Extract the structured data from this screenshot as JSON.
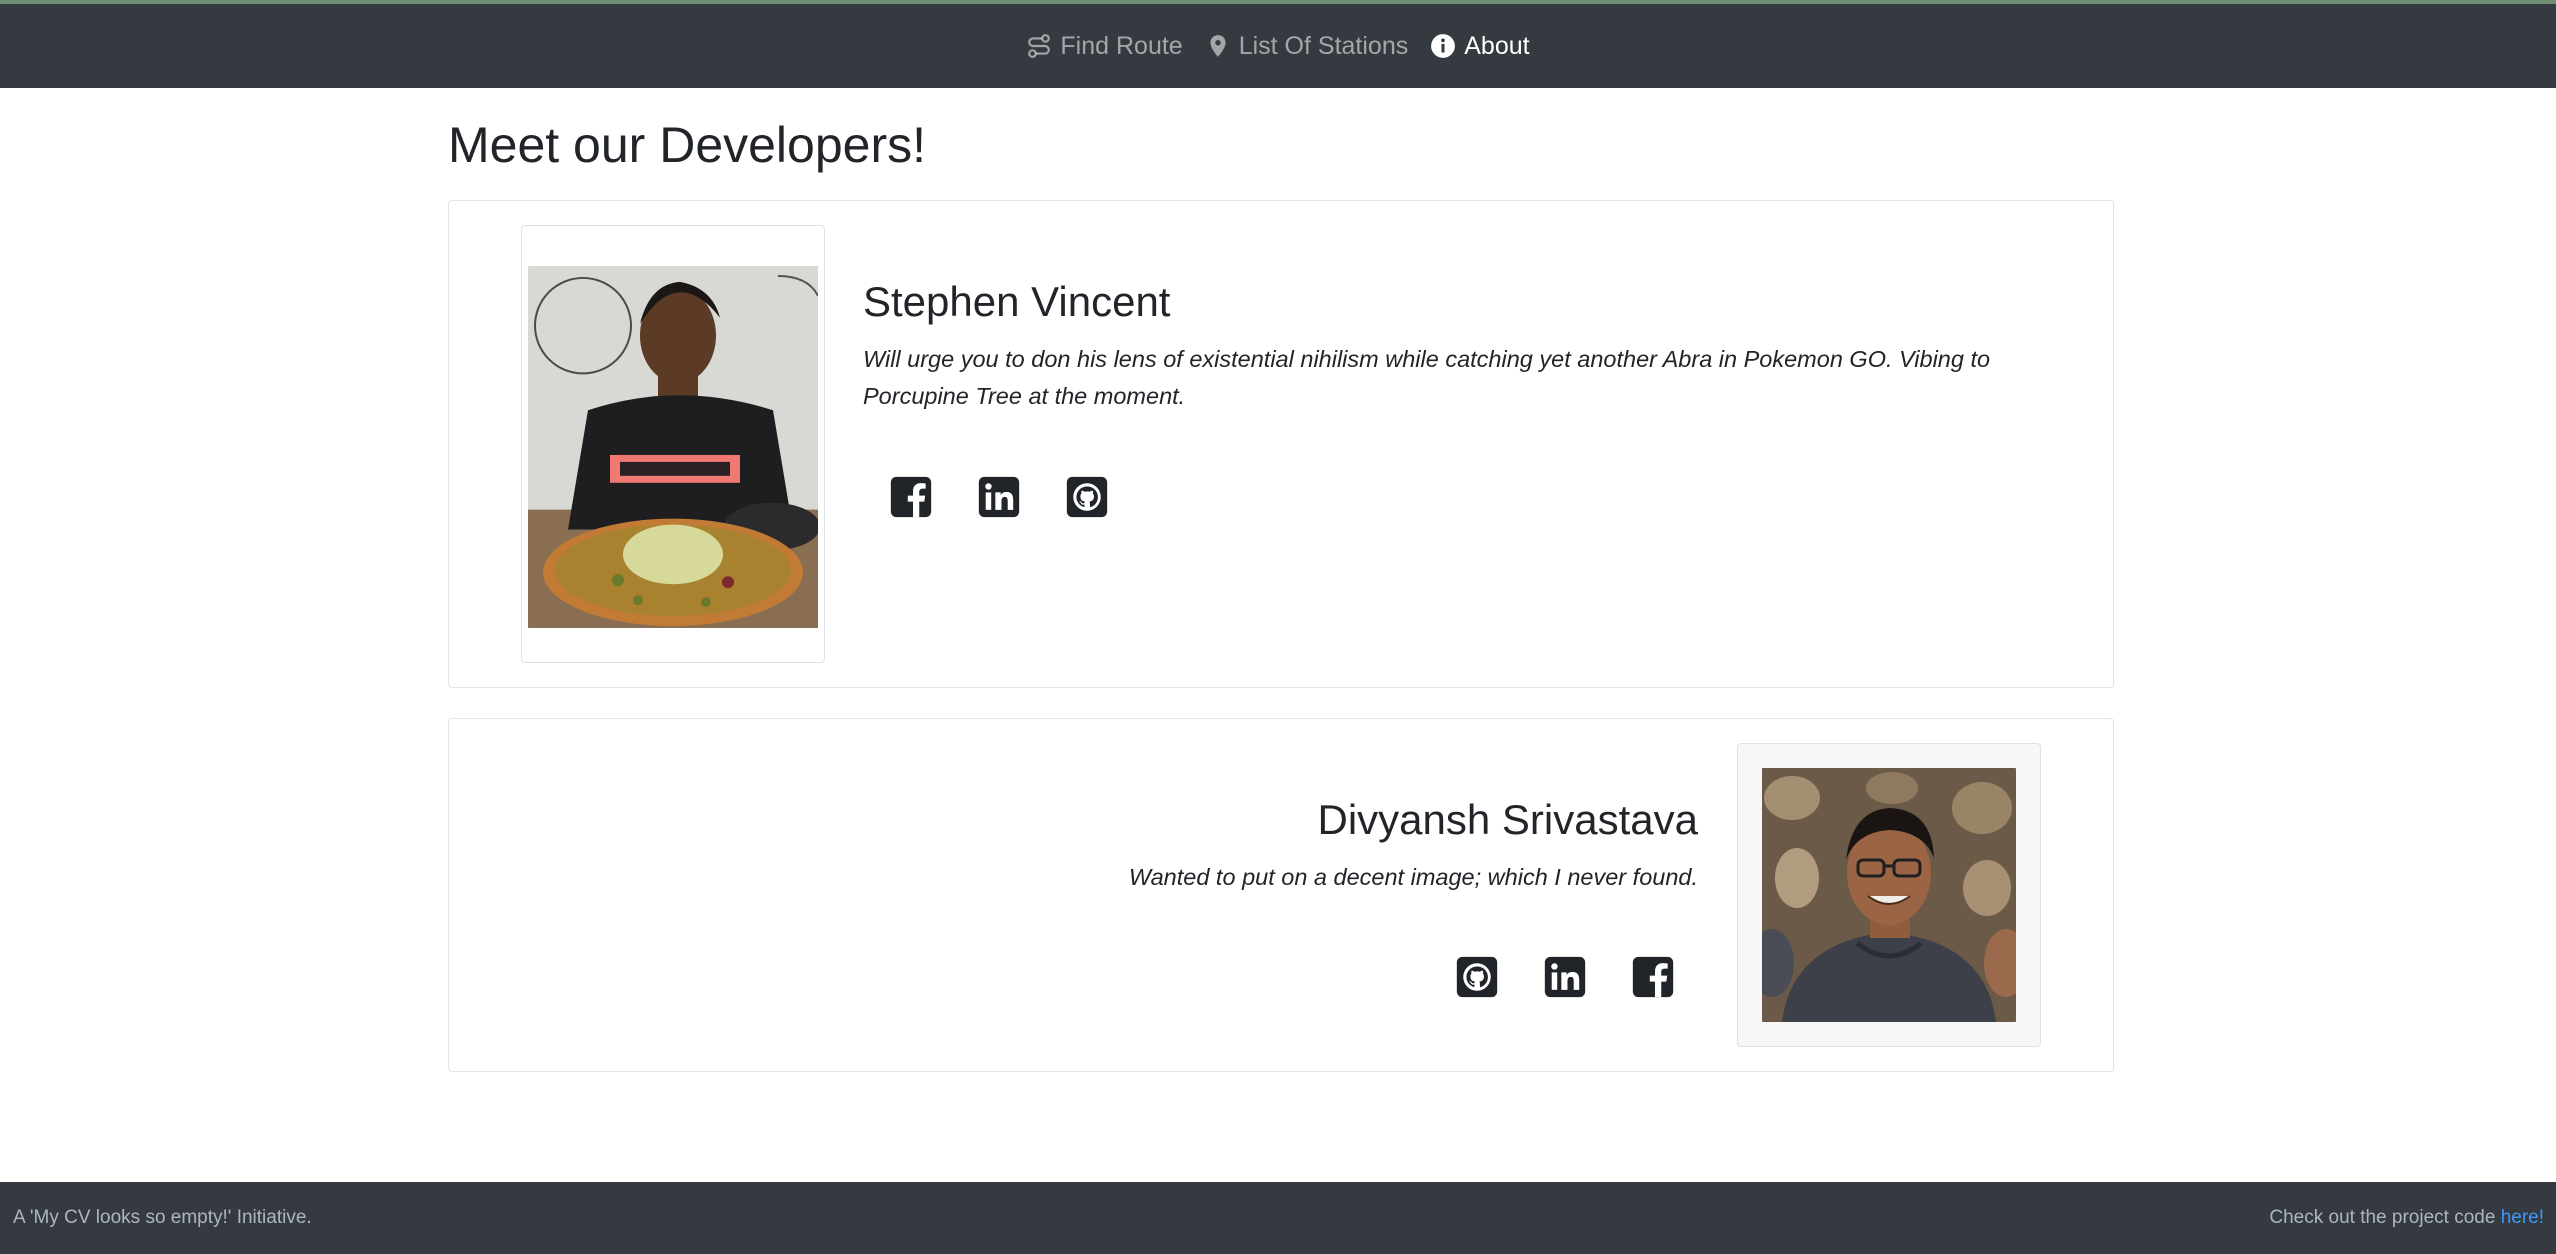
{
  "navbar": {
    "items": [
      {
        "label": "Find Route",
        "icon": "route-icon",
        "active": false
      },
      {
        "label": "List Of Stations",
        "icon": "map-marker-icon",
        "active": false
      },
      {
        "label": "About",
        "icon": "info-circle-icon",
        "active": true
      }
    ]
  },
  "page": {
    "title": "Meet our Developers!"
  },
  "developers": [
    {
      "name": "Stephen Vincent",
      "bio": "Will urge you to don his lens of existential nihilism while catching yet another Abra in Pokemon GO. Vibing to Porcupine Tree at the moment.",
      "photo_icon": "developer-photo",
      "socials": [
        "facebook-icon",
        "linkedin-icon",
        "github-icon"
      ]
    },
    {
      "name": "Divyansh Srivastava",
      "bio": "Wanted to put on a decent image; which I never found.",
      "photo_icon": "developer-photo",
      "socials": [
        "github-icon",
        "linkedin-icon",
        "facebook-icon"
      ]
    }
  ],
  "footer": {
    "left_text": "A 'My CV looks so empty!' Initiative.",
    "right_text": "Check out the project code",
    "right_link": "here!"
  },
  "colors": {
    "navbar_bg": "#343a40",
    "link": "#3b99fc",
    "text": "#212529"
  }
}
